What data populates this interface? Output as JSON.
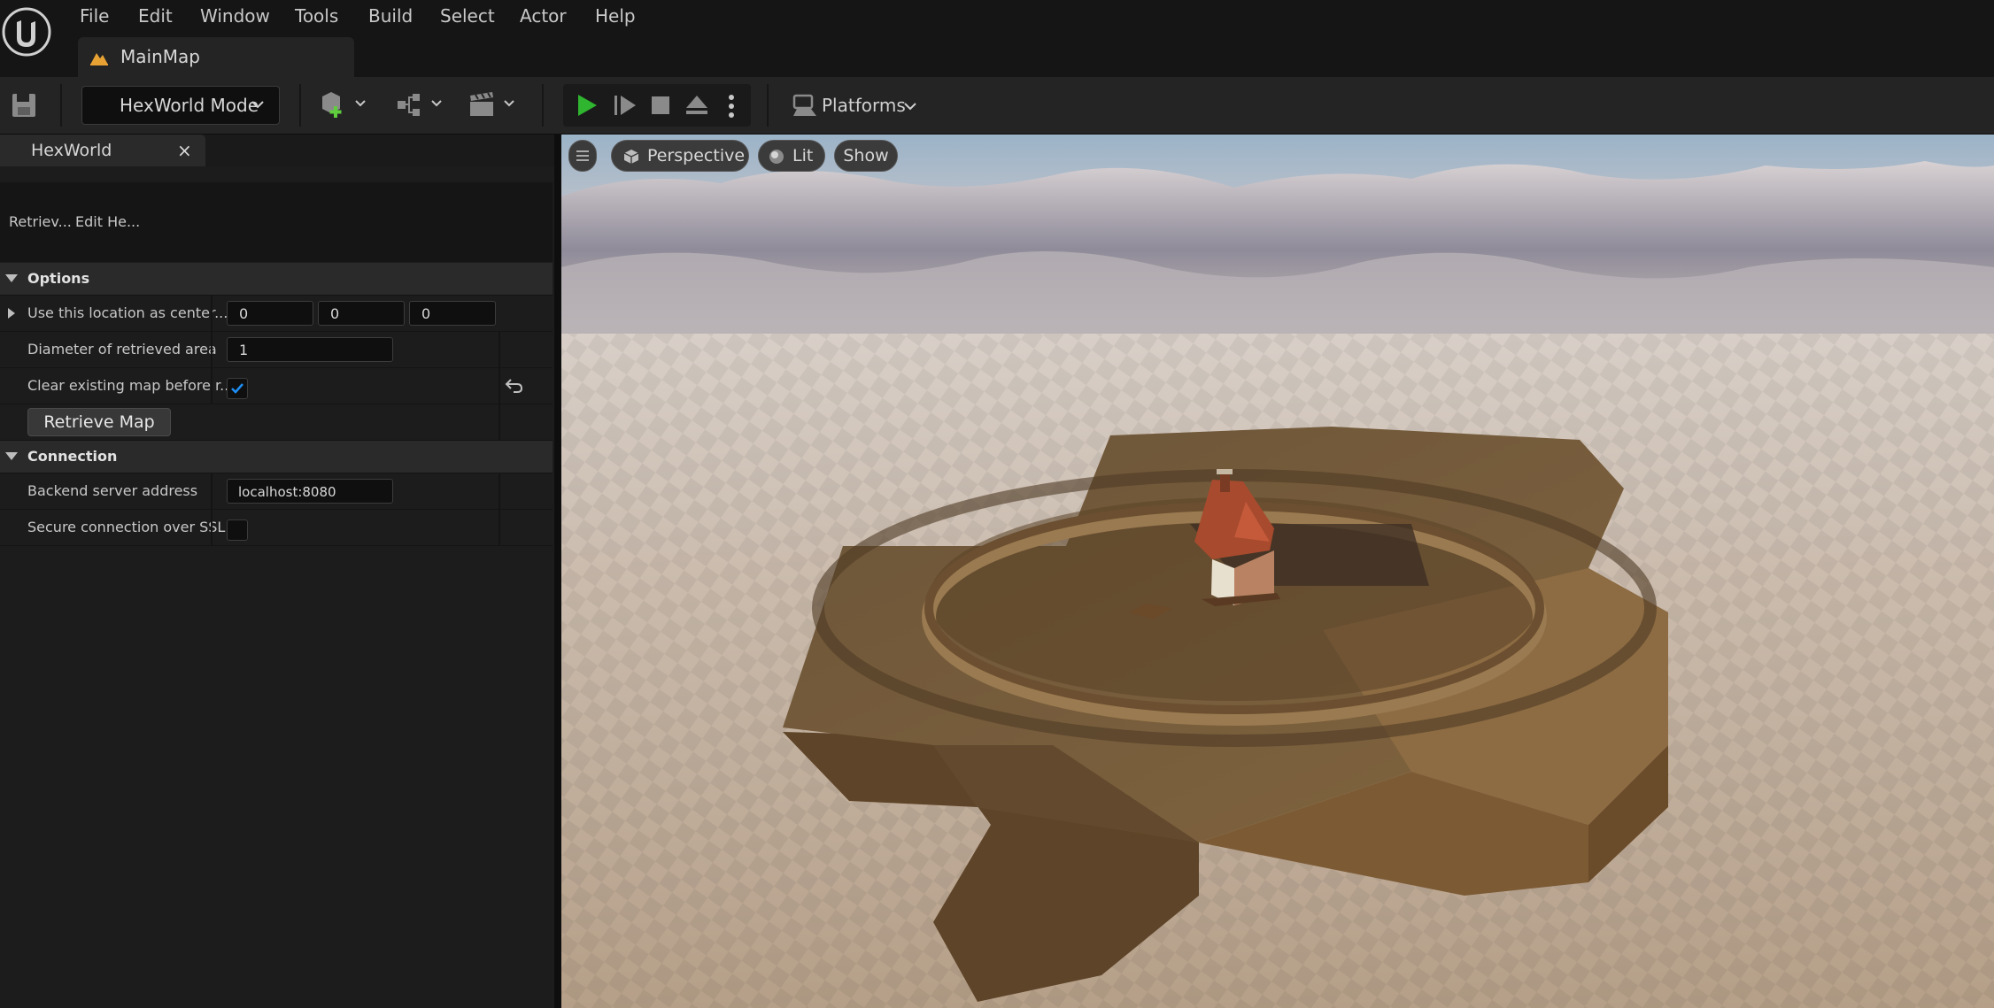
{
  "menu": {
    "items": [
      "File",
      "Edit",
      "Window",
      "Tools",
      "Build",
      "Select",
      "Actor",
      "Help"
    ]
  },
  "document_tab": {
    "label": "MainMap"
  },
  "toolbar": {
    "mode_label": "HexWorld Mode",
    "platforms_label": "Platforms"
  },
  "panel": {
    "tab_label": "HexWorld",
    "close_glyph": "×",
    "subtabs": [
      "Retriev...",
      "Edit He..."
    ],
    "categories": {
      "options": {
        "label": "Options",
        "center_label": "Use this location as center...",
        "center_x": "0",
        "center_y": "0",
        "center_z": "0",
        "diameter_label": "Diameter of retrieved area",
        "diameter_value": "1",
        "clear_label": "Clear existing map before r...",
        "clear_checked": true,
        "retrieve_button": "Retrieve Map"
      },
      "connection": {
        "label": "Connection",
        "server_label": "Backend server address",
        "server_value": "localhost:8080",
        "ssl_label": "Secure connection over SSL",
        "ssl_checked": false
      }
    }
  },
  "viewport": {
    "view_mode": "Perspective",
    "lighting": "Lit",
    "show_label": "Show"
  },
  "colors": {
    "accent": "#1e8ef5",
    "play_green": "#2fb52f",
    "background": "#151515",
    "panel": "#1c1c1c"
  }
}
